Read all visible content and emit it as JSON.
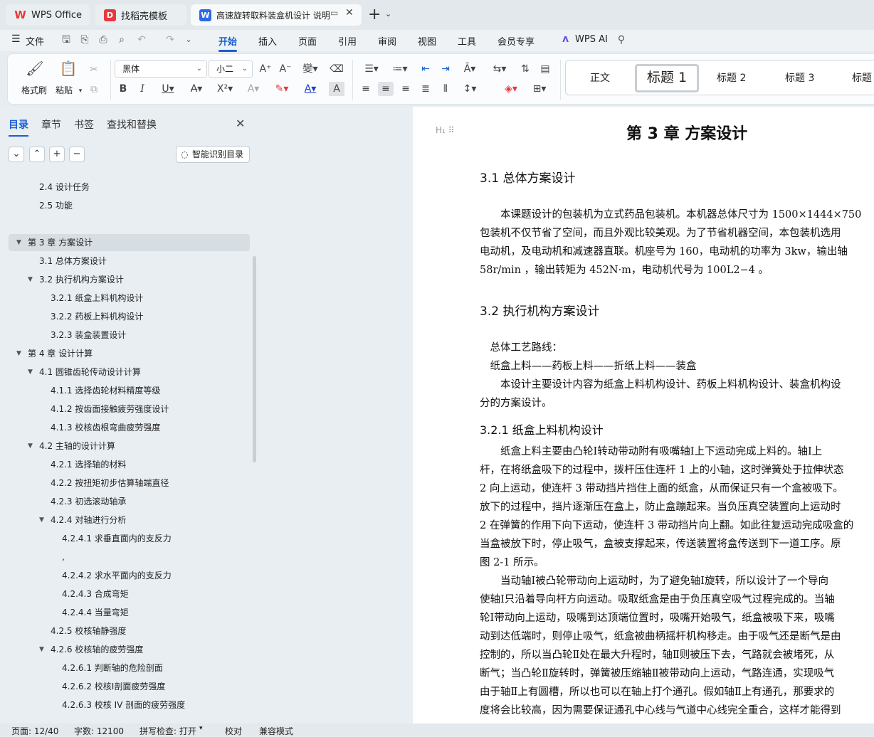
{
  "tabs": [
    {
      "label": "WPS Office",
      "icon": "wps-logo-icon",
      "color": "#e8383d"
    },
    {
      "label": "找稻壳模板",
      "icon": "docer-logo-icon",
      "color": "#e8383d"
    },
    {
      "label": "高速旋转取料装盒机设计 说明",
      "icon": "writer-logo-icon",
      "color": "#2b6ae8"
    }
  ],
  "menu": {
    "file": "文件",
    "items": [
      "开始",
      "插入",
      "页面",
      "引用",
      "审阅",
      "视图",
      "工具",
      "会员专享"
    ],
    "ai": "WPS AI"
  },
  "ribbon": {
    "format_painter": "格式刷",
    "paste": "粘贴",
    "font": "黑体",
    "size": "小二",
    "styles": {
      "normal": "正文",
      "h1": "标题 1",
      "h2": "标题 2",
      "h3": "标题 3",
      "h4": "标题"
    }
  },
  "nav": {
    "tabs": [
      "目录",
      "章节",
      "书签",
      "查找和替换"
    ],
    "smart_button": "智能识别目录",
    "toc": [
      "2.4 设计任务",
      "2.5 功能",
      "第 3 章 方案设计",
      "3.1 总体方案设计",
      "3.2 执行机构方案设计",
      "3.2.1 纸盒上料机构设计",
      "3.2.2 药板上料机构设计",
      "3.2.3 装盒装置设计",
      "第 4 章 设计计算",
      "4.1 圆锥齿轮传动设计计算",
      "4.1.1 选择齿轮材料精度等级",
      "4.1.2 按齿面接触疲劳强度设计",
      "4.1.3 校核齿根弯曲疲劳强度",
      "4.2 主轴的设计计算",
      "4.2.1 选择轴的材料",
      "4.2.2 按扭矩初步估算轴端直径",
      "4.2.3 初选滚动轴承",
      "4.2.4 对轴进行分析",
      "4.2.4.1 求垂直面内的支反力",
      ",",
      "4.2.4.2 求水平面内的支反力",
      "4.2.4.3 合成弯矩",
      "4.2.4.4 当量弯矩",
      "4.2.5 校核轴静强度",
      "4.2.6 校核轴的疲劳强度",
      "4.2.6.1 判断轴的危险剖面",
      "4.2.6.2 校核Ⅰ剖面疲劳强度",
      "4.2.6.3 校核 IV 剖面的疲劳强度"
    ]
  },
  "doc": {
    "title": "第 3 章 方案设计",
    "h31": "3.1 总体方案设计",
    "p1": [
      "　　本课题设计的包装机为立式药品包装机。本机器总体尺寸为 1500×1444×750",
      "包装机不仅节省了空间，而且外观比较美观。为了节省机器空间，本包装机选用",
      "电动机，及电动机和减速器直联。机座号为 160，电动机的功率为 3kw，输出轴",
      "58r/min ，输出转矩为 452N·m，电动机代号为 100L2−4 。"
    ],
    "h32": "3.2 执行机构方案设计",
    "p2": [
      "　总体工艺路线：",
      "　纸盒上料——药板上料——折纸上料——装盒",
      "　　本设计主要设计内容为纸盒上料机构设计、药板上料机构设计、装盒机构设",
      "分的方案设计。"
    ],
    "h321": "3.2.1 纸盒上料机构设计",
    "p3": [
      "　　纸盒上料主要由凸轮Ⅰ转动带动附有吸嘴轴Ⅰ上下运动完成上料的。轴Ⅰ上",
      "杆，在将纸盒吸下的过程中，拨杆压住连杆 1 上的小轴，这时弹簧处于拉伸状态",
      "2 向上运动，使连杆 3 带动挡片挡住上面的纸盒，从而保证只有一个盒被吸下。",
      "放下的过程中，挡片逐渐压在盒上，防止盒蹦起来。当负压真空装置向上运动时",
      "2 在弹簧的作用下向下运动，使连杆 3 带动挡片向上翻。如此往复运动完成吸盒的",
      "当盒被放下时，停止吸气，盒被支撑起来，传送装置将盒传送到下一道工序。原",
      "图 2-1 所示。",
      "　　当动轴Ⅰ被凸轮带动向上运动时，为了避免轴Ⅰ旋转，所以设计了一个导向",
      "使轴Ⅰ只沿着导向杆方向运动。吸取纸盒是由于负压真空吸气过程完成的。当轴",
      "轮Ⅰ带动向上运动，吸嘴到达顶端位置时，吸嘴开始吸气，纸盒被吸下来，吸嘴",
      "动到达低端时，则停止吸气，纸盒被曲柄摇杆机构移走。由于吸气还是断气是由",
      "控制的，所以当凸轮Ⅱ处在最大升程时，轴Ⅱ则被压下去，气路就会被堵死，从",
      "断气；当凸轮Ⅱ旋转时，弹簧被压缩轴Ⅱ被带动向上运动，气路连通，实现吸气",
      "由于轴Ⅱ上有圆槽，所以也可以在轴上打个通孔。假如轴Ⅱ上有通孔，那要求的",
      "度将会比较高，因为需要保证通孔中心线与气道中心线完全重合，这样才能得到"
    ]
  },
  "status": {
    "page": "页面: 12/40",
    "words": "字数: 12100",
    "spell": "拼写检查: 打开",
    "proof": "校对",
    "compat": "兼容模式"
  }
}
